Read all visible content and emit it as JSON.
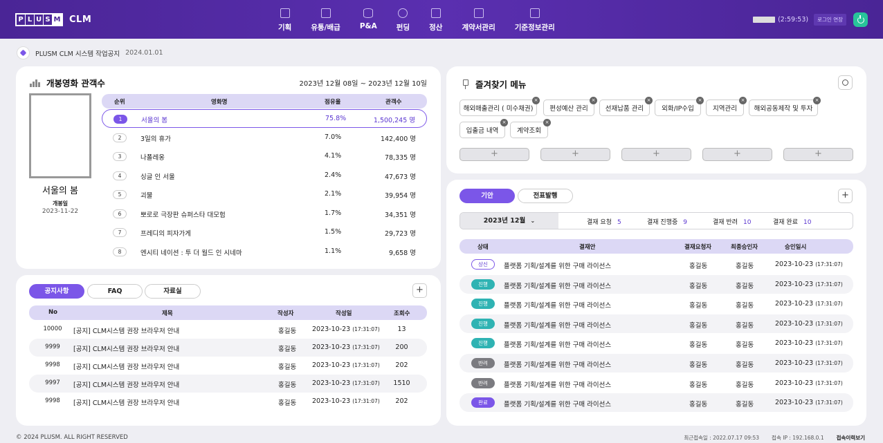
{
  "header": {
    "logo_letters": [
      "P",
      "L",
      "U",
      "S",
      "M"
    ],
    "logo_app": "CLM",
    "nav": [
      {
        "label": "기획",
        "icon": "document-icon"
      },
      {
        "label": "유통/배급",
        "icon": "film-icon"
      },
      {
        "label": "P&A",
        "icon": "database-icon"
      },
      {
        "label": "펀딩",
        "icon": "coin-icon"
      },
      {
        "label": "정산",
        "icon": "calculator-icon"
      },
      {
        "label": "계약서관리",
        "icon": "contract-icon"
      },
      {
        "label": "기준정보관리",
        "icon": "flag-icon"
      }
    ],
    "timer": "(2:59:53)",
    "extend_label": "로그인 연장"
  },
  "notice": {
    "text": "PLUSM CLM 시스템 작업공지",
    "date": "2024.01.01"
  },
  "box_office": {
    "title": "개봉영화 관객수",
    "range": "2023년 12월 08일 ~ 2023년 12월 10일",
    "featured_title": "서울의 봄",
    "release_label": "개봉일",
    "release_date": "2023-11-22",
    "columns": [
      "순위",
      "영화명",
      "점유율",
      "관객수"
    ],
    "rows": [
      {
        "rank": "1",
        "title": "서울의 봄",
        "share": "75.8%",
        "audience": "1,500,245 명"
      },
      {
        "rank": "2",
        "title": "3일의 휴가",
        "share": "7.0%",
        "audience": "142,400 명"
      },
      {
        "rank": "3",
        "title": "나폴레옹",
        "share": "4.1%",
        "audience": "78,335 명"
      },
      {
        "rank": "4",
        "title": "싱글 인 서울",
        "share": "2.4%",
        "audience": "47,673 명"
      },
      {
        "rank": "5",
        "title": "괴물",
        "share": "2.1%",
        "audience": "39,954 명"
      },
      {
        "rank": "6",
        "title": "뽀로로 극장판 슈퍼스타 대모험",
        "share": "1.7%",
        "audience": "34,351 명"
      },
      {
        "rank": "7",
        "title": "프레디의 피자가게",
        "share": "1.5%",
        "audience": "29,723 명"
      },
      {
        "rank": "8",
        "title": "엔시티 네이션 : 투 더 월드 인 시네마",
        "share": "1.1%",
        "audience": "9,658 명"
      }
    ]
  },
  "favorites": {
    "title": "즐겨찾기 메뉴",
    "chips": [
      "해외매출관리 ( 미수채권)",
      "편성예산 관리",
      "선재납품 관리",
      "외화/IP수입",
      "지역관리",
      "해외공동제작 및 투자",
      "입출금 내역",
      "계약조회"
    ],
    "add_slot_label": "+",
    "close_glyph": "×"
  },
  "approval": {
    "tabs": [
      "기안",
      "전표발행"
    ],
    "add_label": "+",
    "month": "2023년 12월",
    "summary": [
      {
        "label": "결재 요청",
        "value": "5"
      },
      {
        "label": "결재 진행중",
        "value": "9"
      },
      {
        "label": "결재 반려",
        "value": "10"
      },
      {
        "label": "결재 완료",
        "value": "10"
      }
    ],
    "columns": [
      "상태",
      "결재안",
      "결재요청자",
      "최종승인자",
      "승인일시"
    ],
    "rows": [
      {
        "status": "상신",
        "kind": "sang",
        "title": "플랫폼 기획/설계를 위한 구매 라이선스",
        "requester": "홍길동",
        "approver": "홍길동",
        "date": "2023-10-23",
        "time": "(17:31:07)"
      },
      {
        "status": "진행",
        "kind": "jin",
        "title": "플랫폼 기획/설계를 위한 구매 라이선스",
        "requester": "홍길동",
        "approver": "홍길동",
        "date": "2023-10-23",
        "time": "(17:31:07)"
      },
      {
        "status": "진행",
        "kind": "jin",
        "title": "플랫폼 기획/설계를 위한 구매 라이선스",
        "requester": "홍길동",
        "approver": "홍길동",
        "date": "2023-10-23",
        "time": "(17:31:07)"
      },
      {
        "status": "진행",
        "kind": "jin",
        "title": "플랫폼 기획/설계를 위한 구매 라이선스",
        "requester": "홍길동",
        "approver": "홍길동",
        "date": "2023-10-23",
        "time": "(17:31:07)"
      },
      {
        "status": "진행",
        "kind": "jin",
        "title": "플랫폼 기획/설계를 위한 구매 라이선스",
        "requester": "홍길동",
        "approver": "홍길동",
        "date": "2023-10-23",
        "time": "(17:31:07)"
      },
      {
        "status": "반려",
        "kind": "ban",
        "title": "플랫폼 기획/설계를 위한 구매 라이선스",
        "requester": "홍길동",
        "approver": "홍길동",
        "date": "2023-10-23",
        "time": "(17:31:07)"
      },
      {
        "status": "반려",
        "kind": "ban",
        "title": "플랫폼 기획/설계를 위한 구매 라이선스",
        "requester": "홍길동",
        "approver": "홍길동",
        "date": "2023-10-23",
        "time": "(17:31:07)"
      },
      {
        "status": "완료",
        "kind": "wan",
        "title": "플랫폼 기획/설계를 위한 구매 라이선스",
        "requester": "홍길동",
        "approver": "홍길동",
        "date": "2023-10-23",
        "time": "(17:31:07)"
      }
    ]
  },
  "board": {
    "tabs": [
      "공지사항",
      "FAQ",
      "자료실"
    ],
    "add_label": "+",
    "columns": [
      "No",
      "제목",
      "작성자",
      "작성일",
      "조회수"
    ],
    "rows": [
      {
        "no": "10000",
        "title": "[공지] CLM시스템 권장 브라우저 안내",
        "author": "홍길동",
        "date": "2023-10-23",
        "time": "(17:31:07)",
        "views": "13"
      },
      {
        "no": "9999",
        "title": "[공지] CLM시스템 권장 브라우저 안내",
        "author": "홍길동",
        "date": "2023-10-23",
        "time": "(17:31:07)",
        "views": "200"
      },
      {
        "no": "9998",
        "title": "[공지] CLM시스템 권장 브라우저 안내",
        "author": "홍길동",
        "date": "2023-10-23",
        "time": "(17:31:07)",
        "views": "202"
      },
      {
        "no": "9997",
        "title": "[공지] CLM시스템 권장 브라우저 안내",
        "author": "홍길동",
        "date": "2023-10-23",
        "time": "(17:31:07)",
        "views": "1510"
      },
      {
        "no": "9998",
        "title": "[공지] CLM시스템 권장 브라우저 안내",
        "author": "홍길동",
        "date": "2023-10-23",
        "time": "(17:31:07)",
        "views": "202"
      }
    ]
  },
  "footer": {
    "copyright": "© 2024 PLUSM. ALL RIGHT RESERVED",
    "last_login": "최근접속일 : 2022.07.17 09:53",
    "ip": "접속 IP : 192.168.0.1",
    "history_link": "접속이력보기"
  },
  "colors": {
    "brand": "#4a2596",
    "accent": "#7b56e8",
    "progress": "#2fb3b3",
    "rejected": "#7b7b80",
    "power": "#28c49a"
  }
}
